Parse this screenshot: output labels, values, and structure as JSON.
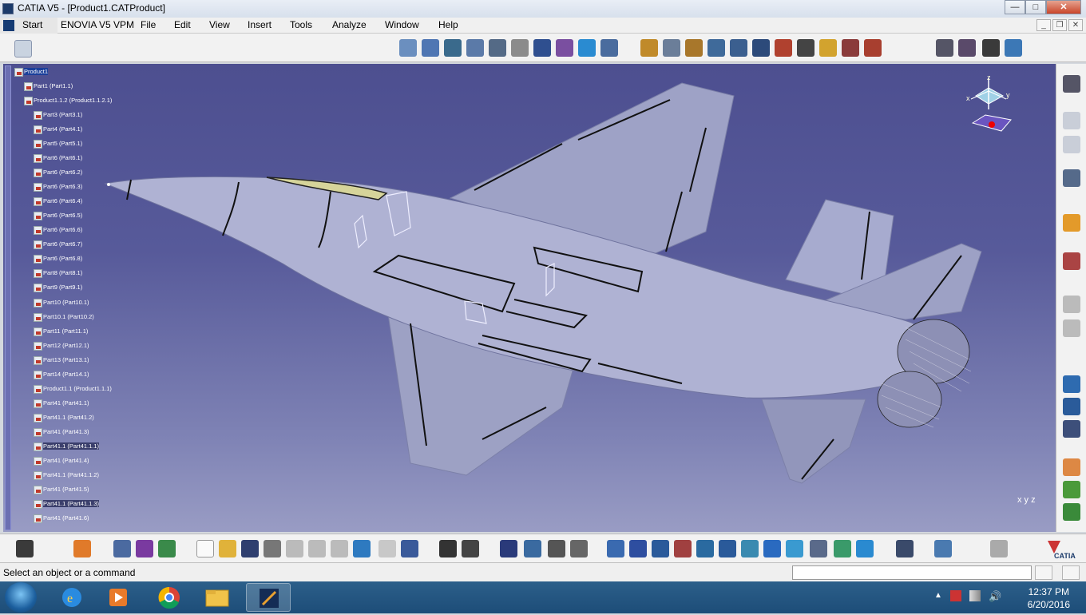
{
  "window": {
    "title": "CATIA V5 - [Product1.CATProduct]",
    "minimize": "—",
    "maximize": "□",
    "close": "✕"
  },
  "menu": {
    "start": "Start",
    "items": [
      "ENOVIA V5 VPM",
      "File",
      "Edit",
      "View",
      "Insert",
      "Tools",
      "Analyze",
      "Window",
      "Help"
    ]
  },
  "tree": {
    "nodes": [
      "Product1",
      "Part1 (Part1.1)",
      "Product1.1.2 (Product1.1.2.1)",
      "Part3 (Part3.1)",
      "Part4 (Part4.1)",
      "Part5 (Part5.1)",
      "Part6 (Part6.1)",
      "Part6 (Part6.2)",
      "Part6 (Part6.3)",
      "Part6 (Part6.4)",
      "Part6 (Part6.5)",
      "Part6 (Part6.6)",
      "Part6 (Part6.7)",
      "Part6 (Part6.8)",
      "Part8 (Part8.1)",
      "Part9 (Part9.1)",
      "Part10 (Part10.1)",
      "Part10.1 (Part10.2)",
      "Part11 (Part11.1)",
      "Part12 (Part12.1)",
      "Part13 (Part13.1)",
      "Part14 (Part14.1)",
      "Product1.1 (Product1.1.1)",
      "Part41 (Part41.1)",
      "Part41.1 (Part41.2)",
      "Part41 (Part41.3)",
      "Part41.1 (Part41.1.1)",
      "Part41 (Part41.4)",
      "Part41.1 (Part41.1.2)",
      "Part41 (Part41.5)",
      "Part41.1 (Part41.1.3)",
      "Part41 (Part41.6)"
    ]
  },
  "compass": {
    "z": "z",
    "x": "x",
    "y": "y"
  },
  "axis_indicator": "x y z",
  "status": {
    "message": "Select an object or a command"
  },
  "taskbar": {
    "time": "12:37 PM",
    "date": "6/20/2016"
  },
  "colors": {
    "viewport_top": "#4d4f90",
    "viewport_bottom": "#999cc4",
    "tree_selected": "#1b3f9a",
    "aircraft": "#a9adcc"
  }
}
